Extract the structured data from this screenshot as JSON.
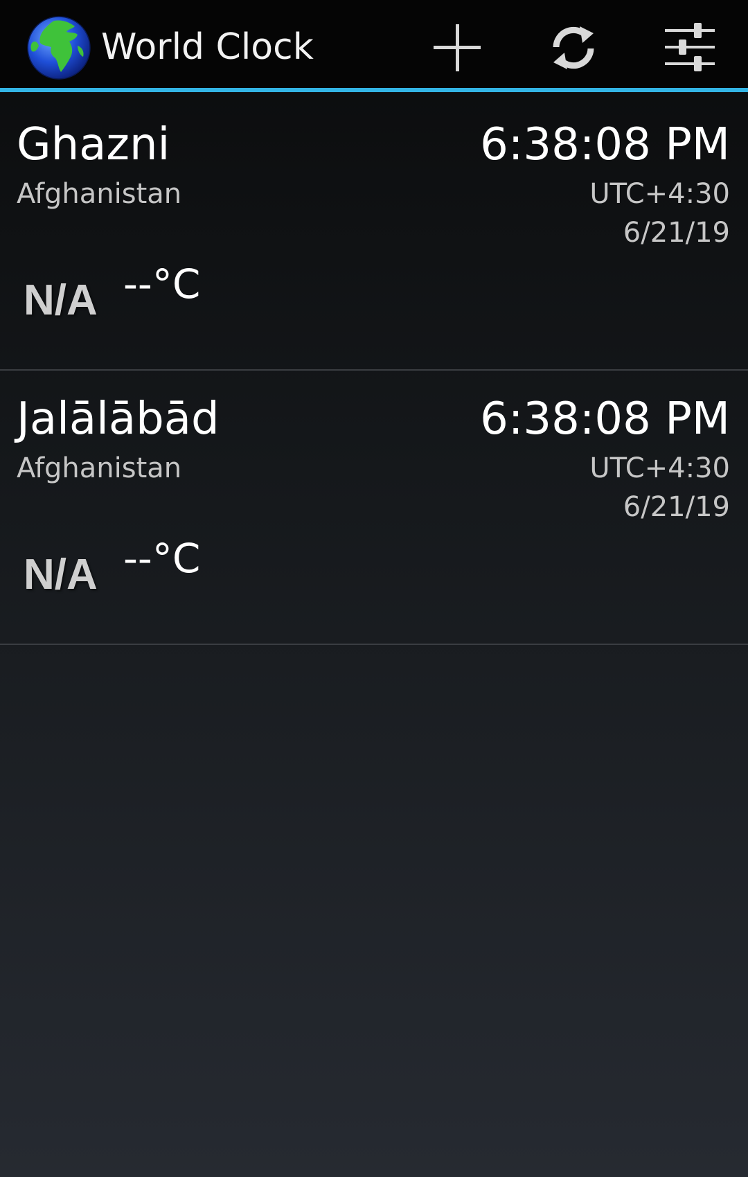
{
  "app": {
    "title": "World Clock"
  },
  "toolbar": {
    "add_icon": "plus-icon",
    "refresh_icon": "refresh-icon",
    "settings_icon": "sliders-icon"
  },
  "colors": {
    "accent": "#33b5e5",
    "action_bar": "#050505",
    "primary_text": "#ffffff",
    "secondary_text": "#c6c6c6"
  },
  "clocks": [
    {
      "city": "Ghazni",
      "country": "Afghanistan",
      "time": "6:38:08 PM",
      "utc_offset": "UTC+4:30",
      "date": "6/21/19",
      "weather_status": "N/A",
      "temperature": "--°C"
    },
    {
      "city": "Jalālābād",
      "country": "Afghanistan",
      "time": "6:38:08 PM",
      "utc_offset": "UTC+4:30",
      "date": "6/21/19",
      "weather_status": "N/A",
      "temperature": "--°C"
    }
  ]
}
